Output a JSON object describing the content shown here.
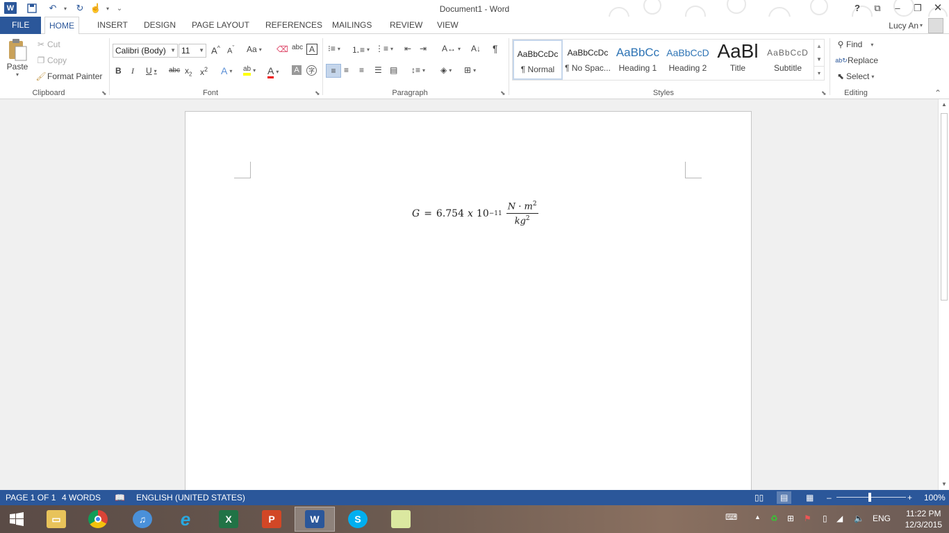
{
  "window": {
    "title": "Document1 - Word"
  },
  "qat": {
    "more": "⌄"
  },
  "tabs": [
    "FILE",
    "HOME",
    "INSERT",
    "DESIGN",
    "PAGE LAYOUT",
    "REFERENCES",
    "MAILINGS",
    "REVIEW",
    "VIEW"
  ],
  "user": {
    "name": "Lucy An"
  },
  "clipboard": {
    "paste": "Paste",
    "cut": "Cut",
    "copy": "Copy",
    "format_painter": "Format Painter",
    "label": "Clipboard"
  },
  "font": {
    "name": "Calibri (Body)",
    "size": "11",
    "label": "Font"
  },
  "paragraph": {
    "label": "Paragraph"
  },
  "styles": {
    "label": "Styles",
    "items": [
      {
        "preview": "AaBbCcDc",
        "name": "¶ Normal"
      },
      {
        "preview": "AaBbCcDc",
        "name": "¶ No Spac..."
      },
      {
        "preview": "AaBbCc",
        "name": "Heading 1"
      },
      {
        "preview": "AaBbCcD",
        "name": "Heading 2"
      },
      {
        "preview": "AaBl",
        "name": "Title"
      },
      {
        "preview": "AaBbCcD",
        "name": "Subtitle"
      }
    ]
  },
  "editing": {
    "find": "Find",
    "replace": "Replace",
    "select": "Select",
    "label": "Editing"
  },
  "document": {
    "equation": {
      "lhs": "G",
      "eq": "=",
      "coef": "6.754",
      "x": "x",
      "base": "10",
      "exp": "−11",
      "num_a": "N",
      "dot": "·",
      "num_b": "m",
      "num_exp": "2",
      "den": "kg",
      "den_exp": "2"
    }
  },
  "status": {
    "page": "PAGE 1 OF 1",
    "words": "4 WORDS",
    "language": "ENGLISH (UNITED STATES)",
    "zoom": "100%"
  },
  "taskbar": {
    "lang": "ENG",
    "time": "11:22 PM",
    "date": "12/3/2015"
  },
  "colors": {
    "accent": "#2b579a",
    "excel": "#217346",
    "powerpoint": "#d24726",
    "skype": "#00aff0"
  }
}
